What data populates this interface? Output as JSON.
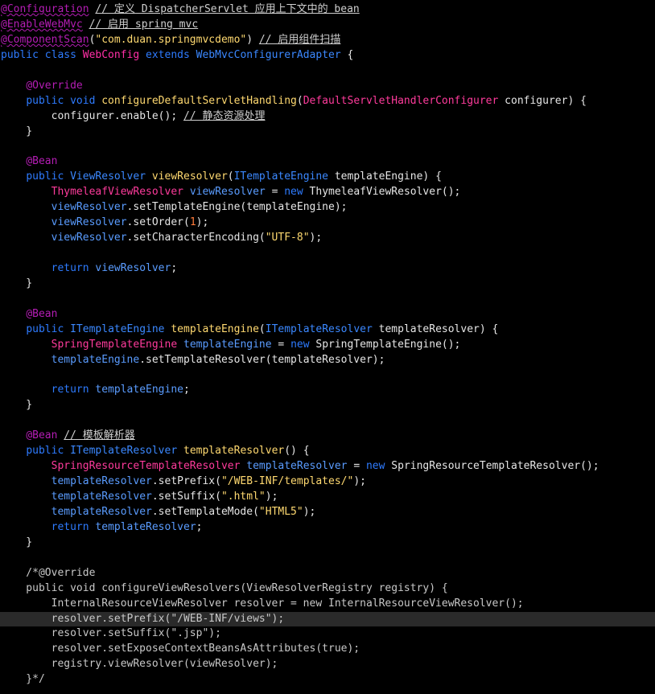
{
  "editor": {
    "lines": [
      [
        {
          "c": "ann-u",
          "t": "@Configuration"
        },
        {
          "c": "plain",
          "t": " "
        },
        {
          "c": "cm-u",
          "t": "// 定义 DispatcherServlet 应用上下文中的 bean"
        }
      ],
      [
        {
          "c": "ann-u",
          "t": "@EnableWebMvc"
        },
        {
          "c": "plain",
          "t": " "
        },
        {
          "c": "cm-u",
          "t": "// 启用 spring mvc"
        }
      ],
      [
        {
          "c": "ann-u",
          "t": "@ComponentScan"
        },
        {
          "c": "punct",
          "t": "("
        },
        {
          "c": "str",
          "t": "\"com.duan.springmvcdemo\""
        },
        {
          "c": "punct",
          "t": ")"
        },
        {
          "c": "plain",
          "t": " "
        },
        {
          "c": "cm-u",
          "t": "// 启用组件扫描"
        }
      ],
      [
        {
          "c": "kw",
          "t": "public class "
        },
        {
          "c": "type-def",
          "t": "WebConfig"
        },
        {
          "c": "kw",
          "t": " extends "
        },
        {
          "c": "typ",
          "t": "WebMvcConfigurerAdapter"
        },
        {
          "c": "punct",
          "t": " {"
        }
      ],
      [],
      [
        {
          "c": "plain",
          "t": "    "
        },
        {
          "c": "ann",
          "t": "@Override"
        }
      ],
      [
        {
          "c": "plain",
          "t": "    "
        },
        {
          "c": "kw",
          "t": "public void "
        },
        {
          "c": "method",
          "t": "configureDefaultServletHandling"
        },
        {
          "c": "punct",
          "t": "("
        },
        {
          "c": "cls",
          "t": "DefaultServletHandlerConfigurer"
        },
        {
          "c": "param",
          "t": " configurer"
        },
        {
          "c": "punct",
          "t": ") {"
        }
      ],
      [
        {
          "c": "plain",
          "t": "        configurer"
        },
        {
          "c": "punct",
          "t": "."
        },
        {
          "c": "plain",
          "t": "enable(); "
        },
        {
          "c": "cm-u",
          "t": "// 静态资源处理"
        }
      ],
      [
        {
          "c": "plain",
          "t": "    }"
        }
      ],
      [],
      [
        {
          "c": "plain",
          "t": "    "
        },
        {
          "c": "ann",
          "t": "@Bean"
        }
      ],
      [
        {
          "c": "plain",
          "t": "    "
        },
        {
          "c": "kw",
          "t": "public "
        },
        {
          "c": "typ",
          "t": "ViewResolver"
        },
        {
          "c": "plain",
          "t": " "
        },
        {
          "c": "method",
          "t": "viewResolver"
        },
        {
          "c": "punct",
          "t": "("
        },
        {
          "c": "typ",
          "t": "ITemplateEngine"
        },
        {
          "c": "param",
          "t": " templateEngine"
        },
        {
          "c": "punct",
          "t": ") {"
        }
      ],
      [
        {
          "c": "plain",
          "t": "        "
        },
        {
          "c": "cls",
          "t": "ThymeleafViewResolver"
        },
        {
          "c": "field",
          "t": " viewResolver"
        },
        {
          "c": "plain",
          "t": " = "
        },
        {
          "c": "kw",
          "t": "new"
        },
        {
          "c": "plain",
          "t": " ThymeleafViewResolver();"
        }
      ],
      [
        {
          "c": "plain",
          "t": "        "
        },
        {
          "c": "field",
          "t": "viewResolver"
        },
        {
          "c": "plain",
          "t": ".setTemplateEngine(templateEngine);"
        }
      ],
      [
        {
          "c": "plain",
          "t": "        "
        },
        {
          "c": "field",
          "t": "viewResolver"
        },
        {
          "c": "plain",
          "t": ".setOrder("
        },
        {
          "c": "num",
          "t": "1"
        },
        {
          "c": "plain",
          "t": ");"
        }
      ],
      [
        {
          "c": "plain",
          "t": "        "
        },
        {
          "c": "field",
          "t": "viewResolver"
        },
        {
          "c": "plain",
          "t": ".setCharacterEncoding("
        },
        {
          "c": "str",
          "t": "\"UTF-8\""
        },
        {
          "c": "plain",
          "t": ");"
        }
      ],
      [],
      [
        {
          "c": "plain",
          "t": "        "
        },
        {
          "c": "kw",
          "t": "return"
        },
        {
          "c": "field",
          "t": " viewResolver"
        },
        {
          "c": "plain",
          "t": ";"
        }
      ],
      [
        {
          "c": "plain",
          "t": "    }"
        }
      ],
      [],
      [
        {
          "c": "plain",
          "t": "    "
        },
        {
          "c": "ann",
          "t": "@Bean"
        }
      ],
      [
        {
          "c": "plain",
          "t": "    "
        },
        {
          "c": "kw",
          "t": "public "
        },
        {
          "c": "typ",
          "t": "ITemplateEngine"
        },
        {
          "c": "plain",
          "t": " "
        },
        {
          "c": "method",
          "t": "templateEngine"
        },
        {
          "c": "punct",
          "t": "("
        },
        {
          "c": "typ",
          "t": "ITemplateResolver"
        },
        {
          "c": "param",
          "t": " templateResolver"
        },
        {
          "c": "punct",
          "t": ") {"
        }
      ],
      [
        {
          "c": "plain",
          "t": "        "
        },
        {
          "c": "cls",
          "t": "SpringTemplateEngine"
        },
        {
          "c": "field",
          "t": " templateEngine"
        },
        {
          "c": "plain",
          "t": " = "
        },
        {
          "c": "kw",
          "t": "new"
        },
        {
          "c": "plain",
          "t": " SpringTemplateEngine();"
        }
      ],
      [
        {
          "c": "plain",
          "t": "        "
        },
        {
          "c": "field",
          "t": "templateEngine"
        },
        {
          "c": "plain",
          "t": ".setTemplateResolver(templateResolver);"
        }
      ],
      [],
      [
        {
          "c": "plain",
          "t": "        "
        },
        {
          "c": "kw",
          "t": "return"
        },
        {
          "c": "field",
          "t": " templateEngine"
        },
        {
          "c": "plain",
          "t": ";"
        }
      ],
      [
        {
          "c": "plain",
          "t": "    }"
        }
      ],
      [],
      [
        {
          "c": "plain",
          "t": "    "
        },
        {
          "c": "ann",
          "t": "@Bean"
        },
        {
          "c": "plain",
          "t": " "
        },
        {
          "c": "cm-u",
          "t": "// 模板解析器"
        }
      ],
      [
        {
          "c": "plain",
          "t": "    "
        },
        {
          "c": "kw",
          "t": "public "
        },
        {
          "c": "typ",
          "t": "ITemplateResolver"
        },
        {
          "c": "plain",
          "t": " "
        },
        {
          "c": "method",
          "t": "templateResolver"
        },
        {
          "c": "punct",
          "t": "() {"
        }
      ],
      [
        {
          "c": "plain",
          "t": "        "
        },
        {
          "c": "cls",
          "t": "SpringResourceTemplateResolver"
        },
        {
          "c": "field",
          "t": " templateResolver"
        },
        {
          "c": "plain",
          "t": " = "
        },
        {
          "c": "kw",
          "t": "new"
        },
        {
          "c": "plain",
          "t": " SpringResourceTemplateResolver();"
        }
      ],
      [
        {
          "c": "plain",
          "t": "        "
        },
        {
          "c": "field",
          "t": "templateResolver"
        },
        {
          "c": "plain",
          "t": ".setPrefix("
        },
        {
          "c": "str",
          "t": "\"/WEB-INF/templates/\""
        },
        {
          "c": "plain",
          "t": ");"
        }
      ],
      [
        {
          "c": "plain",
          "t": "        "
        },
        {
          "c": "field",
          "t": "templateResolver"
        },
        {
          "c": "plain",
          "t": ".setSuffix("
        },
        {
          "c": "str",
          "t": "\".html\""
        },
        {
          "c": "plain",
          "t": ");"
        }
      ],
      [
        {
          "c": "plain",
          "t": "        "
        },
        {
          "c": "field",
          "t": "templateResolver"
        },
        {
          "c": "plain",
          "t": ".setTemplateMode("
        },
        {
          "c": "str",
          "t": "\"HTML5\""
        },
        {
          "c": "plain",
          "t": ");"
        }
      ],
      [
        {
          "c": "plain",
          "t": "        "
        },
        {
          "c": "kw",
          "t": "return"
        },
        {
          "c": "field",
          "t": " templateResolver"
        },
        {
          "c": "plain",
          "t": ";"
        }
      ],
      [
        {
          "c": "plain",
          "t": "    }"
        }
      ],
      [],
      [
        {
          "c": "dim",
          "t": "    /*@Override"
        }
      ],
      [
        {
          "c": "dim",
          "t": "    public void configureViewResolvers(ViewResolverRegistry registry) {"
        }
      ],
      [
        {
          "c": "dim",
          "t": "        InternalResourceViewResolver resolver = new InternalResourceViewResolver();"
        }
      ],
      [
        {
          "c": "dim",
          "t": "        resolver.setPrefix(\"/WEB-INF/views\");"
        }
      ],
      [
        {
          "c": "dim",
          "t": "        resolver.setSuffix(\".jsp\");"
        }
      ],
      [
        {
          "c": "dim",
          "t": "        resolver.setExposeContextBeansAsAttributes(true);"
        }
      ],
      [
        {
          "c": "dim",
          "t": "        registry.viewResolver(viewResolver);"
        }
      ],
      [
        {
          "c": "dim",
          "t": "    }*/"
        }
      ]
    ],
    "current_line_index": 40
  }
}
